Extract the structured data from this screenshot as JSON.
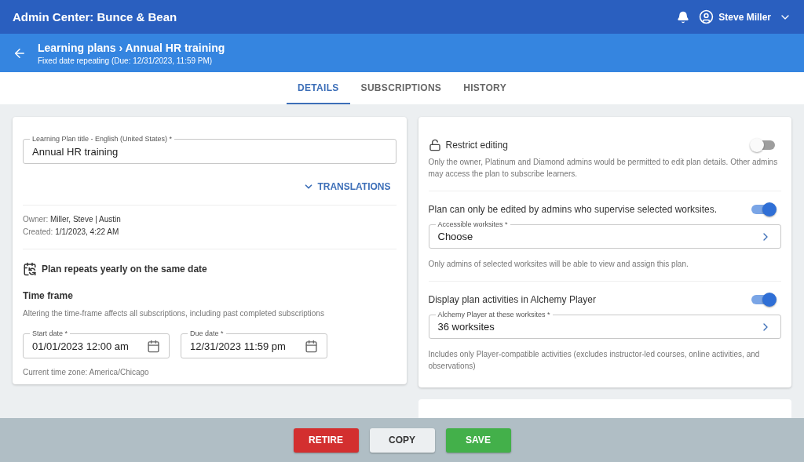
{
  "app_bar": {
    "title": "Admin Center: Bunce & Bean",
    "user": "Steve Miller"
  },
  "header": {
    "breadcrumb": "Learning plans › Annual HR training",
    "subtitle": "Fixed date repeating (Due: 12/31/2023, 11:59 PM)"
  },
  "tabs": [
    {
      "label": "DETAILS",
      "selected": true
    },
    {
      "label": "SUBSCRIPTIONS",
      "selected": false
    },
    {
      "label": "HISTORY",
      "selected": false
    }
  ],
  "details": {
    "title_field": {
      "label": "Learning Plan title - English (United States) *",
      "value": "Annual HR training"
    },
    "translations": "TRANSLATIONS",
    "meta": [
      {
        "label": "Owner:",
        "value": "Miller, Steve | Austin"
      },
      {
        "label": "Created:",
        "value": "1/1/2023, 4:22 AM"
      }
    ],
    "repeat": "Plan repeats yearly on the same date",
    "time_frame": {
      "heading": "Time frame",
      "note": "Altering the time-frame affects all subscriptions, including past completed subscriptions",
      "dates": [
        {
          "label": "Start date *",
          "value": "01/01/2023 12:00 am"
        },
        {
          "label": "Due date *",
          "value": "12/31/2023 11:59 pm"
        }
      ],
      "time_zone": "Current time zone: America/Chicago"
    }
  },
  "settings": [
    {
      "kind": "lock",
      "title": "Restrict editing",
      "on": false,
      "note": "Only the owner, Platinum and Diamond admins would be permitted to edit plan details. Other admins may access the plan to subscribe learners."
    },
    {
      "kind": "select",
      "title": "Plan can only be edited by admins who supervise selected worksites.",
      "on": true,
      "field": {
        "label": "Accessible worksites *",
        "value": "Choose"
      },
      "note": "Only admins of selected worksites will be able to view and assign this plan."
    },
    {
      "kind": "select",
      "title": "Display plan activities in Alchemy Player",
      "on": true,
      "field": {
        "label": "Alchemy Player at these worksites *",
        "value": "36 worksites"
      },
      "note": "Includes only Player-compatible activities (excludes instructor-led courses, online activities, and observations)"
    }
  ],
  "buttons": [
    {
      "kind": "retire",
      "label": "RETIRE"
    },
    {
      "kind": "copy",
      "label": "COPY"
    },
    {
      "kind": "save",
      "label": "SAVE"
    }
  ]
}
